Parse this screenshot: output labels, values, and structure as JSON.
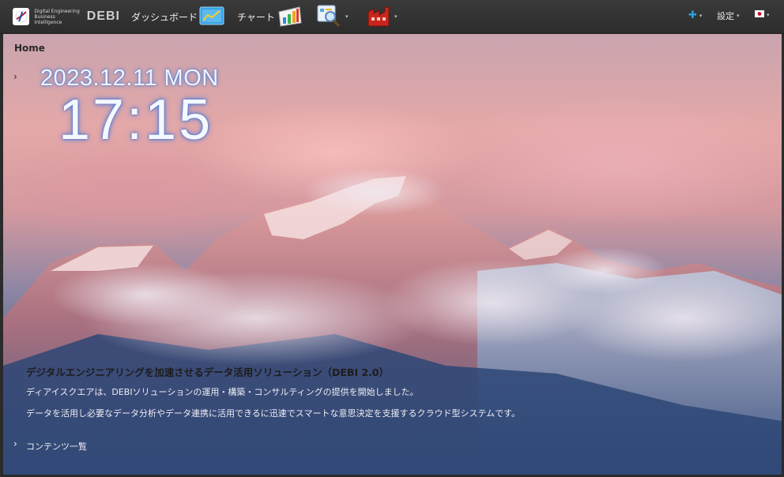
{
  "navbar": {
    "logo": {
      "text_line1": "Digital Engineering",
      "text_line2": "Business Intelligence",
      "brand": "DEBI"
    },
    "dashboard_label": "ダッシュボード",
    "chart_label": "チャート",
    "search_menu_icon": "magnifier-report-icon",
    "factory_menu_icon": "factory-icon",
    "add_icon": "plus-icon",
    "settings_label": "設定",
    "language_icon": "japan-flag-icon",
    "accent_color": "#2b9fe0"
  },
  "hero": {
    "breadcrumb": "Home",
    "date": "2023.12.11 MON",
    "time": "17:15",
    "info_title": "デジタルエンジニアリングを加速させるデータ活用ソリューション（DEBI 2.0）",
    "info_line1": "ディアイスクエアは、DEBIソリューションの運用・構築・コンサルティングの提供を開始しました。",
    "info_line2": "データを活用し必要なデータ分析やデータ連携に活用できるに迅速でスマートな意思決定を支援するクラウド型システムです。",
    "contents_link": "コンテンツ一覧"
  }
}
